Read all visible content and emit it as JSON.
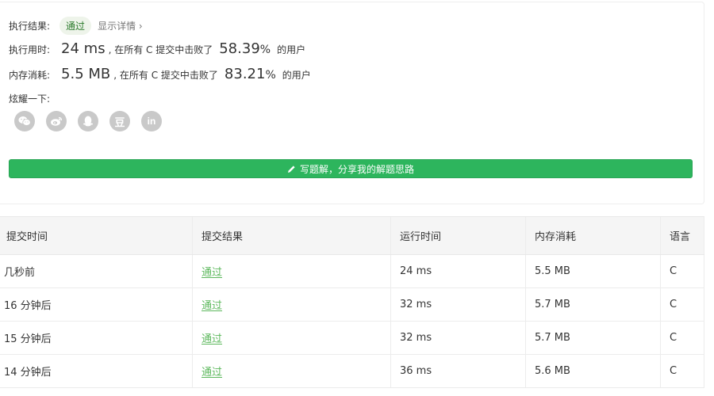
{
  "result": {
    "label": "执行结果:",
    "status": "通过",
    "detail_link": "显示详情 ›"
  },
  "runtime": {
    "label": "执行用时:",
    "value": "24 ms",
    "middle_text": ", 在所有 C 提交中击败了",
    "percent": "58.39",
    "percent_symbol": "%",
    "suffix": "的用户"
  },
  "memory": {
    "label": "内存消耗:",
    "value": "5.5 MB",
    "middle_text": ", 在所有 C 提交中击败了",
    "percent": "83.21",
    "percent_symbol": "%",
    "suffix": "的用户"
  },
  "share": {
    "label": "炫耀一下:",
    "icons": [
      "wechat-icon",
      "weibo-icon",
      "qq-icon",
      "douban-icon",
      "linkedin-icon"
    ],
    "douban_text": "豆",
    "linkedin_text": "in"
  },
  "write_solution": {
    "label": "写题解，分享我的解题思路",
    "icon": "pencil-icon",
    "color": "#2db55d"
  },
  "submissions": {
    "headers": [
      "提交时间",
      "提交结果",
      "运行时间",
      "内存消耗",
      "语言"
    ],
    "rows": [
      {
        "time": "几秒前",
        "result": "通过",
        "runtime": "24 ms",
        "memory": "5.5 MB",
        "lang": "C"
      },
      {
        "time": "16 分钟后",
        "result": "通过",
        "runtime": "32 ms",
        "memory": "5.7 MB",
        "lang": "C"
      },
      {
        "time": "15 分钟后",
        "result": "通过",
        "runtime": "32 ms",
        "memory": "5.7 MB",
        "lang": "C"
      },
      {
        "time": "14 分钟后",
        "result": "通过",
        "runtime": "36 ms",
        "memory": "5.6 MB",
        "lang": "C"
      }
    ],
    "pass_color": "#5cb85c"
  }
}
